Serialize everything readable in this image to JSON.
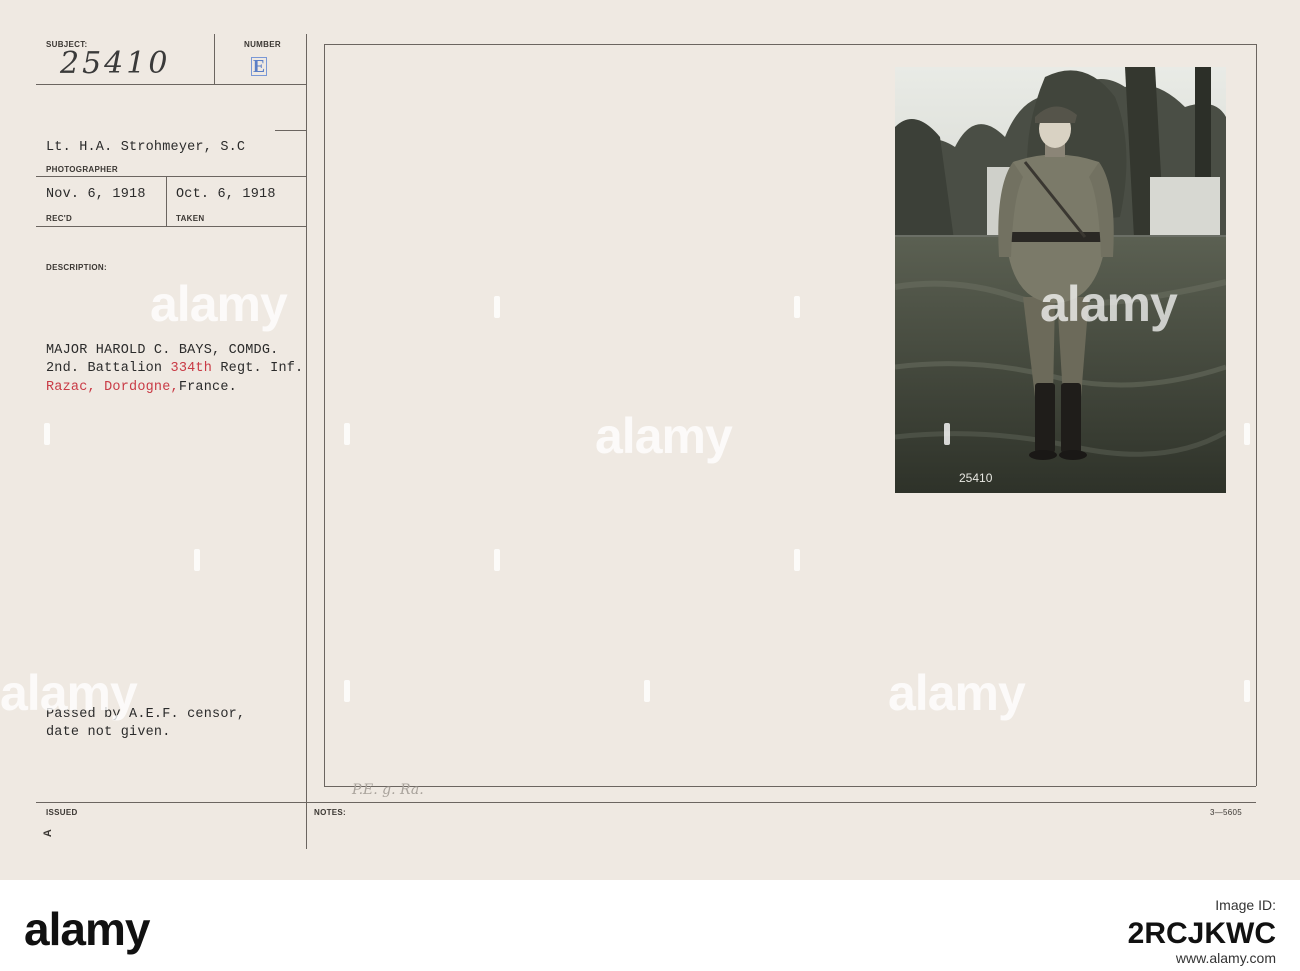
{
  "card": {
    "subject_label": "SUBJECT:",
    "subject_number": "25410",
    "number_label": "NUMBER",
    "number_stamp": "E",
    "photographer": "Lt. H.A. Strohmeyer, S.C",
    "photographer_label": "PHOTOGRAPHER",
    "recd_date": "Nov. 6, 1918",
    "recd_label": "REC'D",
    "taken_date": "Oct. 6, 1918",
    "taken_label": "TAKEN",
    "description_label": "DESCRIPTION:",
    "description": {
      "line1": "MAJOR HAROLD C. BAYS, COMDG.",
      "line2_pre": "2nd. Battalion ",
      "line2_red": "334th",
      "line2_post": " Regt. Inf.",
      "line3_red": "Razac, Dordogne,",
      "line3_post": "France."
    },
    "censor_line1": "Passed by A.E.F. censor,",
    "censor_line2": "date not given.",
    "issued_label": "ISSUED",
    "notes_label": "NOTES:",
    "notes_handwritten": "P.E. g. Ra.",
    "form_code": "3—5605",
    "edge_mark": "A",
    "photo_number": "25410"
  },
  "watermark": {
    "text": "alamy"
  },
  "footer": {
    "logo": "alamy",
    "image_id_label": "Image ID:",
    "image_id": "2RCJKWC",
    "url": "www.alamy.com"
  },
  "colors": {
    "card": "#efe9e2",
    "typed_text": "#2b2b2b",
    "red_type": "#c93a45",
    "stamp_blue": "#5b7ec6",
    "footer": "#ffffff"
  }
}
